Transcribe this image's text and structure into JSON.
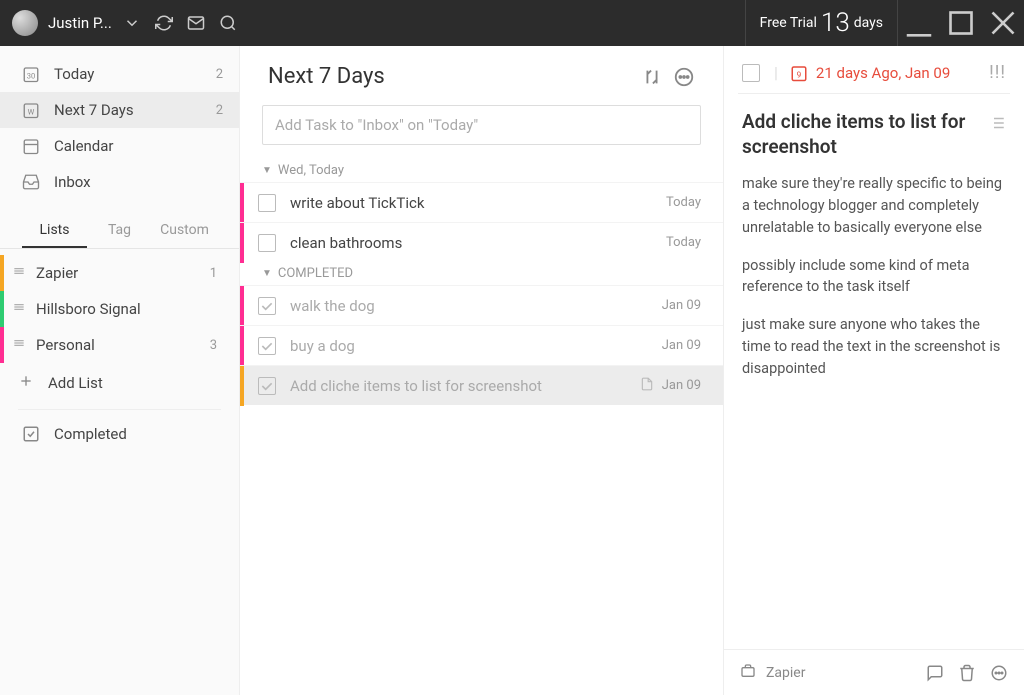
{
  "titlebar": {
    "username": "Justin P...",
    "trial_prefix": "Free Trial",
    "trial_days": "13",
    "trial_suffix": "days"
  },
  "sidebar": {
    "smart_lists": [
      {
        "name": "today",
        "label": "Today",
        "count": "2",
        "active": false
      },
      {
        "name": "next7",
        "label": "Next 7 Days",
        "count": "2",
        "active": true
      },
      {
        "name": "calendar",
        "label": "Calendar",
        "count": "",
        "active": false
      },
      {
        "name": "inbox",
        "label": "Inbox",
        "count": "",
        "active": false
      }
    ],
    "tabs": [
      {
        "label": "Lists",
        "active": true
      },
      {
        "label": "Tag",
        "active": false
      },
      {
        "label": "Custom",
        "active": false
      }
    ],
    "lists": [
      {
        "label": "Zapier",
        "count": "1",
        "color": "#f5a623"
      },
      {
        "label": "Hillsboro Signal",
        "count": "",
        "color": "#2ecc71"
      },
      {
        "label": "Personal",
        "count": "3",
        "color": "#ff2d92"
      }
    ],
    "add_list_label": "Add List",
    "completed_label": "Completed"
  },
  "main": {
    "title": "Next 7 Days",
    "add_placeholder": "Add Task to \"Inbox\" on \"Today\"",
    "sections": [
      {
        "label": "Wed, Today",
        "type": "open",
        "tasks": [
          {
            "title": "write about TickTick",
            "date": "Today",
            "color": "#ff2d92",
            "done": false,
            "selected": false,
            "has_note": false
          },
          {
            "title": "clean bathrooms",
            "date": "Today",
            "color": "#ff2d92",
            "done": false,
            "selected": false,
            "has_note": false
          }
        ]
      },
      {
        "label": "COMPLETED",
        "type": "done",
        "tasks": [
          {
            "title": "walk the dog",
            "date": "Jan 09",
            "color": "#ff2d92",
            "done": true,
            "selected": false,
            "has_note": false
          },
          {
            "title": "buy a dog",
            "date": "Jan 09",
            "color": "#ff2d92",
            "done": true,
            "selected": false,
            "has_note": false
          },
          {
            "title": "Add cliche items to list for screenshot",
            "date": "Jan 09",
            "color": "#f5a623",
            "done": true,
            "selected": true,
            "has_note": true
          }
        ]
      }
    ]
  },
  "detail": {
    "date_text": "21 days Ago, Jan 09",
    "date_num": "9",
    "title": "Add cliche items to list for screenshot",
    "paragraphs": [
      "make sure they're really specific to being a technology blogger and completely unrelatable to basically everyone else",
      "possibly include some kind of meta reference to the task itself",
      "just make sure anyone who takes the time to read the text in the screenshot is disappointed"
    ],
    "project": "Zapier"
  }
}
